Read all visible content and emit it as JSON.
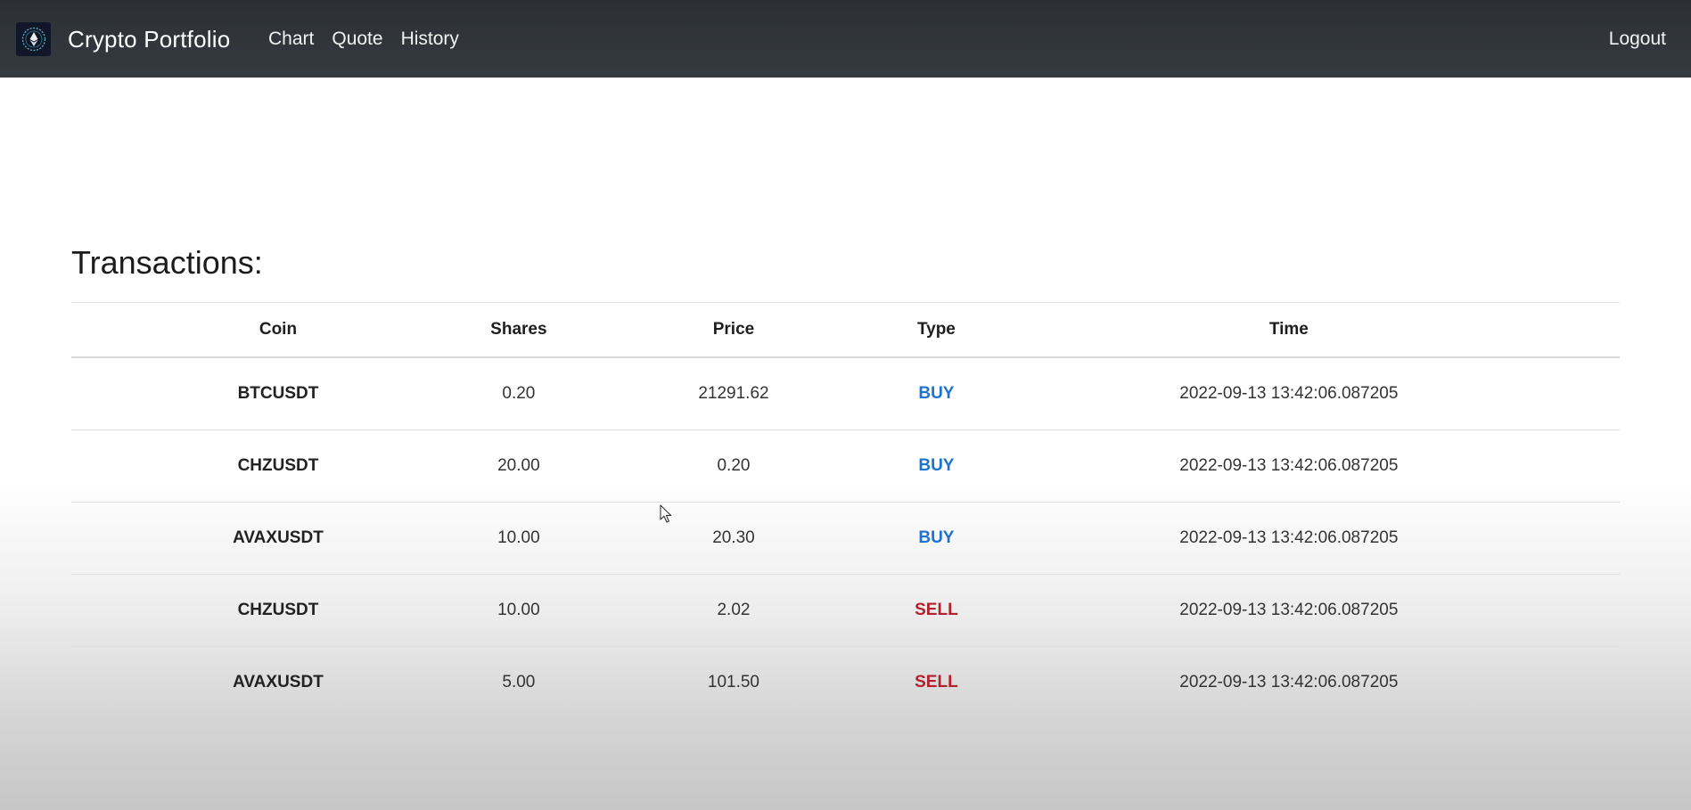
{
  "nav": {
    "brand": "Crypto Portfolio",
    "links": [
      {
        "label": "Chart"
      },
      {
        "label": "Quote"
      },
      {
        "label": "History"
      }
    ],
    "logout": "Logout"
  },
  "page": {
    "title": "Transactions:"
  },
  "table": {
    "headers": [
      "Coin",
      "Shares",
      "Price",
      "Type",
      "Time"
    ],
    "rows": [
      {
        "coin": "BTCUSDT",
        "shares": "0.20",
        "price": "21291.62",
        "type": "BUY",
        "time": "2022-09-13 13:42:06.087205"
      },
      {
        "coin": "CHZUSDT",
        "shares": "20.00",
        "price": "0.20",
        "type": "BUY",
        "time": "2022-09-13 13:42:06.087205"
      },
      {
        "coin": "AVAXUSDT",
        "shares": "10.00",
        "price": "20.30",
        "type": "BUY",
        "time": "2022-09-13 13:42:06.087205"
      },
      {
        "coin": "CHZUSDT",
        "shares": "10.00",
        "price": "2.02",
        "type": "SELL",
        "time": "2022-09-13 13:42:06.087205"
      },
      {
        "coin": "AVAXUSDT",
        "shares": "5.00",
        "price": "101.50",
        "type": "SELL",
        "time": "2022-09-13 13:42:06.087205"
      }
    ]
  },
  "colors": {
    "navbar": "#343a40",
    "buy": "#1e73d0",
    "sell": "#b3202e"
  },
  "icons": {
    "brand": "ethereum-logo-icon",
    "cursor": "mouse-pointer-icon"
  }
}
